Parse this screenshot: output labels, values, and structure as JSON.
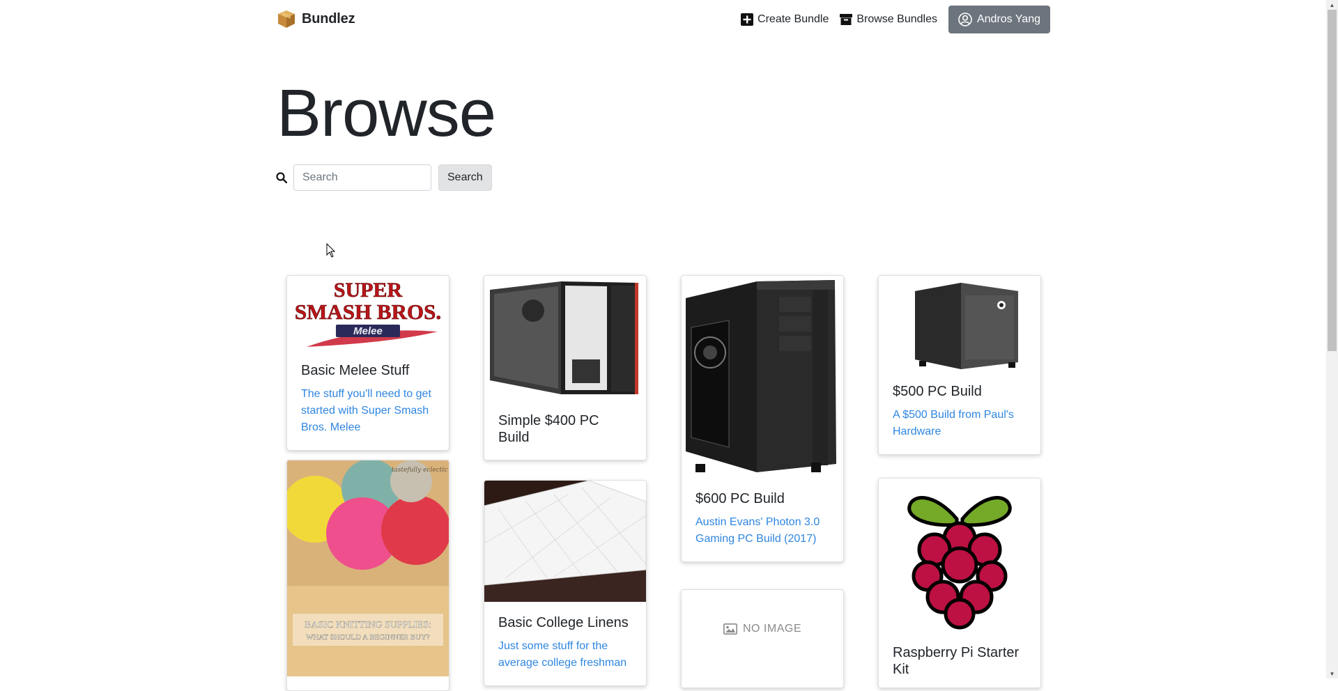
{
  "brand": {
    "name": "Bundlez",
    "logo_icon": "box-icon"
  },
  "nav": {
    "create_label": "Create Bundle",
    "create_icon": "plus-square-icon",
    "browse_label": "Browse Bundles",
    "browse_icon": "archive-icon",
    "user_label": "Andros Yang",
    "user_icon": "user-circle-icon"
  },
  "page": {
    "title": "Browse"
  },
  "search": {
    "placeholder": "Search",
    "value": "",
    "button_label": "Search",
    "icon": "search-icon"
  },
  "colors": {
    "user_button": "#6c757d",
    "link_text": "#2f86e0",
    "search_button": "#e2e3e5"
  },
  "cards": [
    {
      "title": "Basic Melee Stuff",
      "description": "The stuff you'll need to get started with Super Smash Bros. Melee",
      "image": "super-smash-bros-melee-logo",
      "image_text_1": "SUPER",
      "image_text_2": "SMASH BROS.",
      "image_text_3": "Melee"
    },
    {
      "title": "Simple $400 PC Build",
      "description": "",
      "image": "pc-case-open-side-panel"
    },
    {
      "title": "$600 PC Build",
      "description": "Austin Evans' Photon 3.0 Gaming PC Build (2017)",
      "image": "black-tower-pc-case"
    },
    {
      "title": "$500 PC Build",
      "description": "A $500 Build from Paul's Hardware",
      "image": "compact-cube-pc-case"
    },
    {
      "title": "Basic Knitting Supplies",
      "description": "",
      "image": "yarn-balls-basket",
      "image_text_1": "BASIC KNITTING SUPPLIES:",
      "image_text_2": "WHAT SHOULD A BEGINNER BUY?",
      "image_watermark": "tastefully eclectic"
    },
    {
      "title": "Basic College Linens",
      "description": "Just some stuff for the average college freshman",
      "image": "quilted-mattress-pad"
    },
    {
      "title": "",
      "description": "",
      "image": "no-image-placeholder",
      "placeholder_label": "NO IMAGE"
    },
    {
      "title": "Raspberry Pi Starter Kit",
      "description": "",
      "image": "raspberry-pi-logo"
    }
  ]
}
